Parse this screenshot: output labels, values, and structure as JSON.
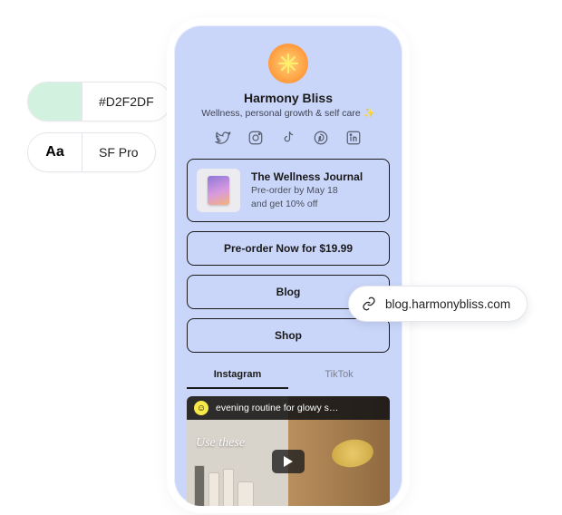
{
  "design_chips": {
    "color_swatch_hex": "#D2F2DF",
    "color_label": "#D2F2DF",
    "font_mark": "Aa",
    "font_label": "SF Pro"
  },
  "profile": {
    "name": "Harmony Bliss",
    "tagline": "Wellness, personal growth & self care ✨"
  },
  "socials": [
    {
      "name": "twitter"
    },
    {
      "name": "instagram"
    },
    {
      "name": "tiktok"
    },
    {
      "name": "pinterest"
    },
    {
      "name": "linkedin"
    }
  ],
  "feature_card": {
    "title": "The Wellness Journal",
    "line1": "Pre-order by May 18",
    "line2": "and get 10% off"
  },
  "buttons": {
    "preorder": "Pre-order Now for $19.99",
    "blog": "Blog",
    "shop": "Shop"
  },
  "tabs": {
    "instagram": "Instagram",
    "tiktok": "TikTok",
    "active": "instagram"
  },
  "video": {
    "title": "evening routine for glowy s…",
    "overlay_text": "Use these"
  },
  "callout": {
    "url": "blog.harmonybliss.com"
  }
}
